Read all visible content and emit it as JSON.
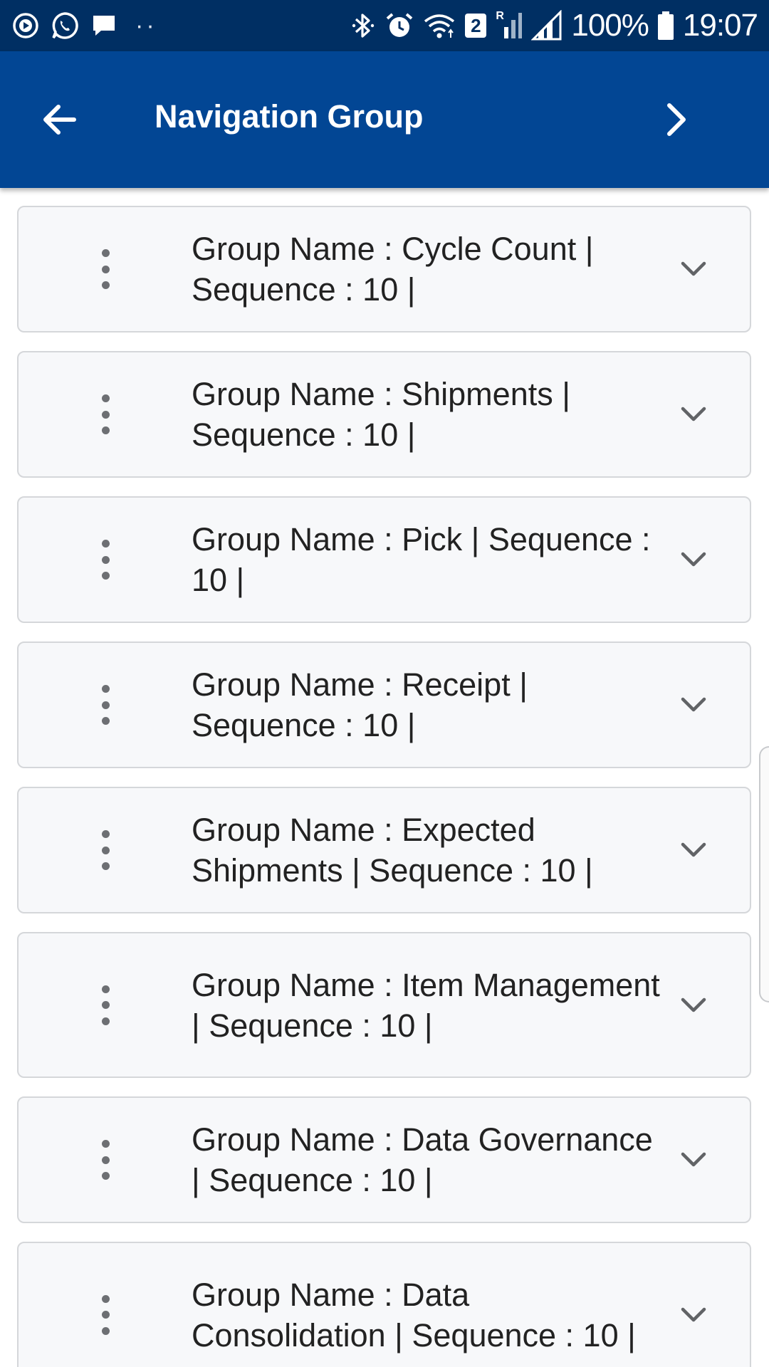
{
  "status_bar": {
    "battery": "100%",
    "time": "19:07",
    "sim_badge": "2",
    "roaming_label": "R",
    "overflow_dots": "··"
  },
  "app_bar": {
    "title": "Navigation Group",
    "background_color": "#024694"
  },
  "groups": [
    {
      "text": "Group Name : Cycle Count | Sequence : 10 |"
    },
    {
      "text": "Group Name : Shipments | Sequence : 10 |"
    },
    {
      "text": "Group Name : Pick | Sequence : 10 |"
    },
    {
      "text": "Group Name : Receipt | Sequence : 10 |"
    },
    {
      "text": "Group Name : Expected Shipments | Sequence : 10 |"
    },
    {
      "text": "Group Name : Item Management | Sequence : 10 |"
    },
    {
      "text": "Group Name : Data Governance | Sequence : 10 |"
    },
    {
      "text": "Group Name : Data Consolidation | Sequence : 10 |"
    }
  ],
  "icons": {
    "back": "arrow-back-icon",
    "next": "chevron-right-icon",
    "item_menu": "more-vert-icon",
    "item_expand": "chevron-down-icon"
  }
}
